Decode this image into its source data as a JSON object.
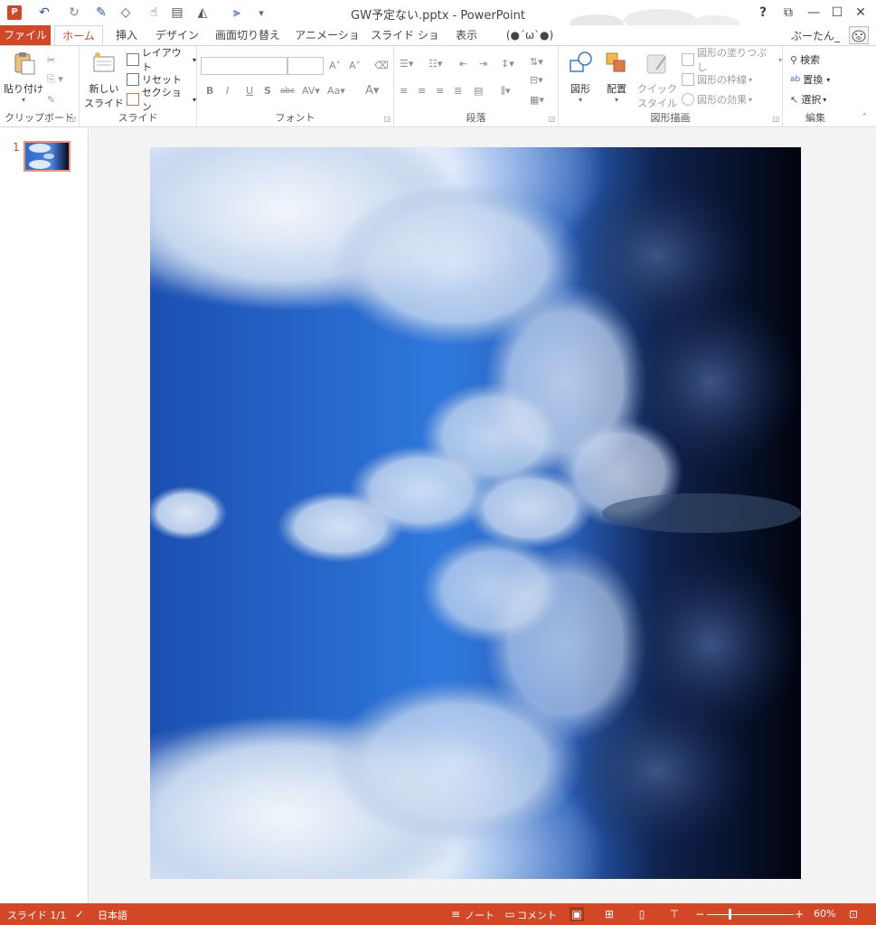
{
  "titlebar": {
    "title": "GW予定ない.pptx - PowerPoint",
    "help": "?",
    "restore": "⧉",
    "minimize": "—",
    "maximize": "☐",
    "close": "✕"
  },
  "tabs": [
    {
      "label": "ファイル"
    },
    {
      "label": "ホーム"
    },
    {
      "label": "挿入"
    },
    {
      "label": "デザイン"
    },
    {
      "label": "画面切り替え"
    },
    {
      "label": "アニメーション"
    },
    {
      "label": "スライド ショー"
    },
    {
      "label": "表示"
    },
    {
      "label": "(●´ω`●)"
    }
  ],
  "user": {
    "name": "ぶーたん_"
  },
  "ribbon": {
    "clipboard": {
      "label": "クリップボード",
      "paste": "貼り付け"
    },
    "slides": {
      "label": "スライド",
      "new_slide_1": "新しい",
      "new_slide_2": "スライド",
      "layout": "レイアウト",
      "reset": "リセット",
      "section": "セクション"
    },
    "font": {
      "label": "フォント"
    },
    "paragraph": {
      "label": "段落"
    },
    "drawing": {
      "label": "図形描画",
      "shapes": "図形",
      "arrange": "配置",
      "quick_1": "クイック",
      "quick_2": "スタイル",
      "fill": "図形の塗りつぶし",
      "outline": "図形の枠線",
      "effects": "図形の効果"
    },
    "editing": {
      "label": "編集",
      "find": "検索",
      "replace": "置換",
      "select": "選択"
    }
  },
  "slides_pane": {
    "slide_number": "1"
  },
  "statusbar": {
    "slide": "スライド 1/1",
    "language": "日本語",
    "notes": "ノート",
    "comments": "コメント",
    "zoom": "60%"
  },
  "colors": {
    "accent": "#d24726"
  }
}
